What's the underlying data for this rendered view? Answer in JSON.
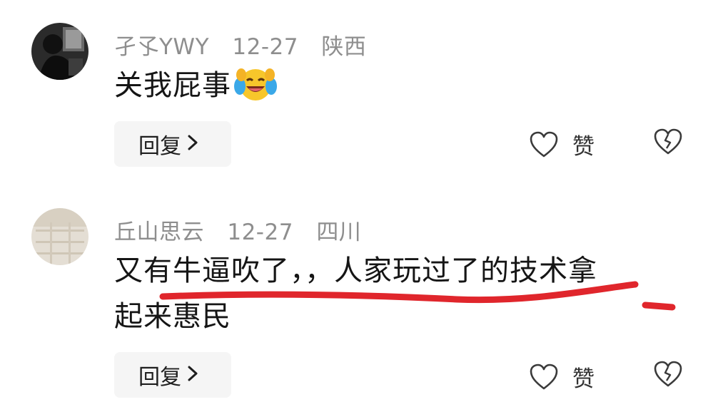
{
  "comments": [
    {
      "username": "孑孓YWY",
      "date": "12-27",
      "location": "陕西",
      "text": "关我屁事",
      "emoji": "laughing-crying-emoji",
      "reply_label": "回复",
      "like_label": "赞"
    },
    {
      "username": "丘山思云",
      "date": "12-27",
      "location": "四川",
      "text_line1": "又有牛逼吹了，，人家玩过了的技术拿",
      "text_line2": "起来惠民",
      "reply_label": "回复",
      "like_label": "赞"
    }
  ],
  "icons": {
    "like": "heart-outline-icon",
    "dislike": "broken-heart-icon",
    "reply_chevron": "chevron-right-icon"
  },
  "colors": {
    "meta": "#8e8e8e",
    "text": "#151515",
    "reply_bg": "#f5f5f5",
    "annotation": "#e0262c"
  }
}
